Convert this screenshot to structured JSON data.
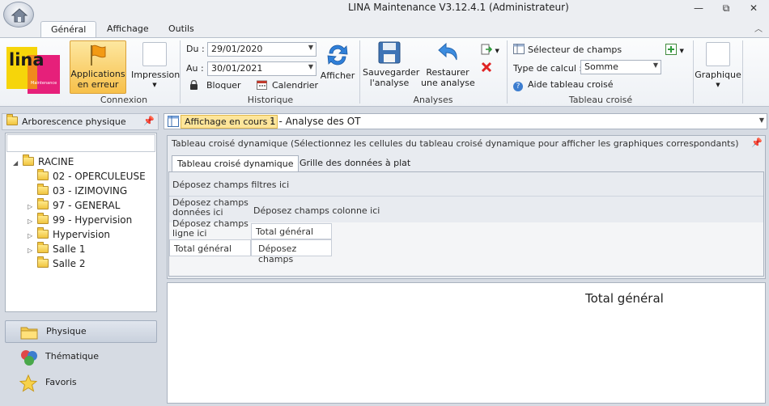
{
  "window": {
    "title": "LINA Maintenance  V3.12.4.1  (Administrateur)",
    "controls": {
      "minimize": "—",
      "restore": "⧉",
      "close": "✕"
    }
  },
  "tabs": [
    {
      "label": "Général",
      "active": true
    },
    {
      "label": "Affichage",
      "active": false
    },
    {
      "label": "Outils",
      "active": false
    }
  ],
  "ribbon": {
    "logo": {
      "text": "lina",
      "sub": "Maintenance"
    },
    "connexion": {
      "label": "Connexion",
      "applications_button": "Applications\nen erreur",
      "impression_button": "Impression"
    },
    "historique": {
      "label": "Historique",
      "du_label": "Du :",
      "du_value": "29/01/2020",
      "au_label": "Au :",
      "au_value": "30/01/2021",
      "bloquer": "Bloquer",
      "calendrier": "Calendrier",
      "afficher": "Afficher"
    },
    "analyses": {
      "label": "Analyses",
      "sauvegarder": "Sauvegarder\nl'analyse",
      "restaurer": "Restaurer\nune analyse"
    },
    "tableau": {
      "label": "Tableau croisé",
      "selecteur": "Sélecteur de champs",
      "type_calcul_label": "Type de calcul :",
      "type_calcul_value": "Somme",
      "aide": "Aide tableau croisé"
    },
    "graphique": {
      "label": "Graphique"
    }
  },
  "left_panel": {
    "header": "Arborescence physique",
    "tree": [
      {
        "label": "RACINE",
        "level": 0,
        "expander": "◢"
      },
      {
        "label": "02 - OPERCULEUSE",
        "level": 1,
        "expander": ""
      },
      {
        "label": "03 - IZIMOVING",
        "level": 1,
        "expander": ""
      },
      {
        "label": "97 - GENERAL",
        "level": 1,
        "expander": "▷"
      },
      {
        "label": "99 - Hypervision",
        "level": 1,
        "expander": "▷"
      },
      {
        "label": "Hypervision",
        "level": 1,
        "expander": "▷"
      },
      {
        "label": "Salle 1",
        "level": 1,
        "expander": "▷"
      },
      {
        "label": "Salle 2",
        "level": 1,
        "expander": ""
      }
    ],
    "nav": [
      {
        "label": "Physique",
        "icon": "folder-icon",
        "active": true
      },
      {
        "label": "Thématique",
        "icon": "circles-icon",
        "active": false
      },
      {
        "label": "Favoris",
        "icon": "star-icon",
        "active": false
      }
    ]
  },
  "main": {
    "affichage_label": "Affichage en cours :",
    "affichage_value": "1 - Analyse des OT",
    "pivot": {
      "caption": "Tableau croisé dynamique (Sélectionnez les cellules du tableau croisé dynamique pour afficher les graphiques correspondants)",
      "tabs": [
        "Tableau croisé dynamique",
        "Grille des données à plat"
      ],
      "filtres": "Déposez champs filtres ici",
      "donnees": "Déposez champs\ndonnées ici",
      "colonne": "Déposez champs colonne ici",
      "ligne": "Déposez champs\nligne ici",
      "total_col": "Total général",
      "total_row": "Total général",
      "deposez": "Déposez champs"
    },
    "chart_title": "Total général"
  }
}
